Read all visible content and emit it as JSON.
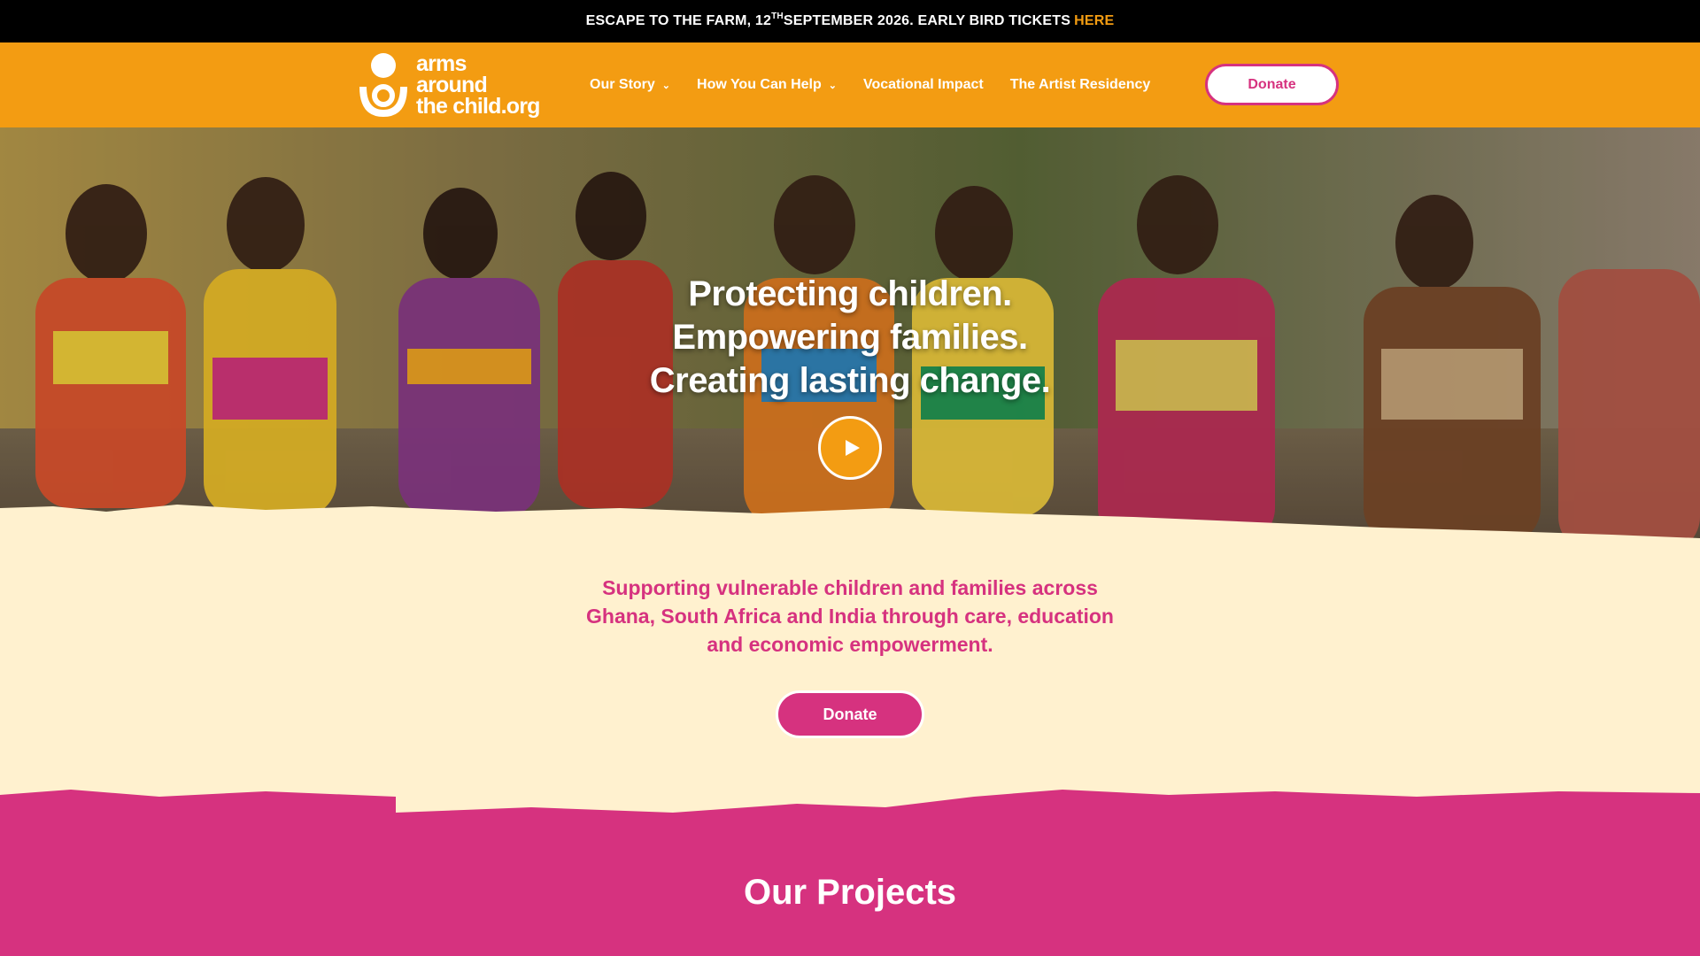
{
  "announcement": {
    "text_before": "ESCAPE TO THE FARM, 12",
    "superscript": "TH",
    "text_after": " SEPTEMBER 2026. EARLY BIRD TICKETS",
    "link": "HERE"
  },
  "header": {
    "logo_line1": "arms around",
    "logo_line2": "the child.org",
    "nav": [
      {
        "label": "Our Story",
        "dropdown": true
      },
      {
        "label": "How You Can Help",
        "dropdown": true
      },
      {
        "label": "Vocational Impact",
        "dropdown": false
      },
      {
        "label": "The Artist Residency",
        "dropdown": false
      }
    ],
    "donate_label": "Donate"
  },
  "hero": {
    "title_line1": "Protecting children.",
    "title_line2": "Empowering families.",
    "title_line3": "Creating lasting change."
  },
  "intro": {
    "text": "Supporting vulnerable children and families across Ghana, South Africa and India through care, education and economic empowerment.",
    "donate_label": "Donate"
  },
  "projects": {
    "title": "Our Projects"
  },
  "colors": {
    "orange": "#f39c12",
    "pink": "#d6327f",
    "cream": "#fff1cf",
    "black": "#000000"
  },
  "icons": {
    "play": "play-icon",
    "chevron": "chevron-down-icon"
  }
}
